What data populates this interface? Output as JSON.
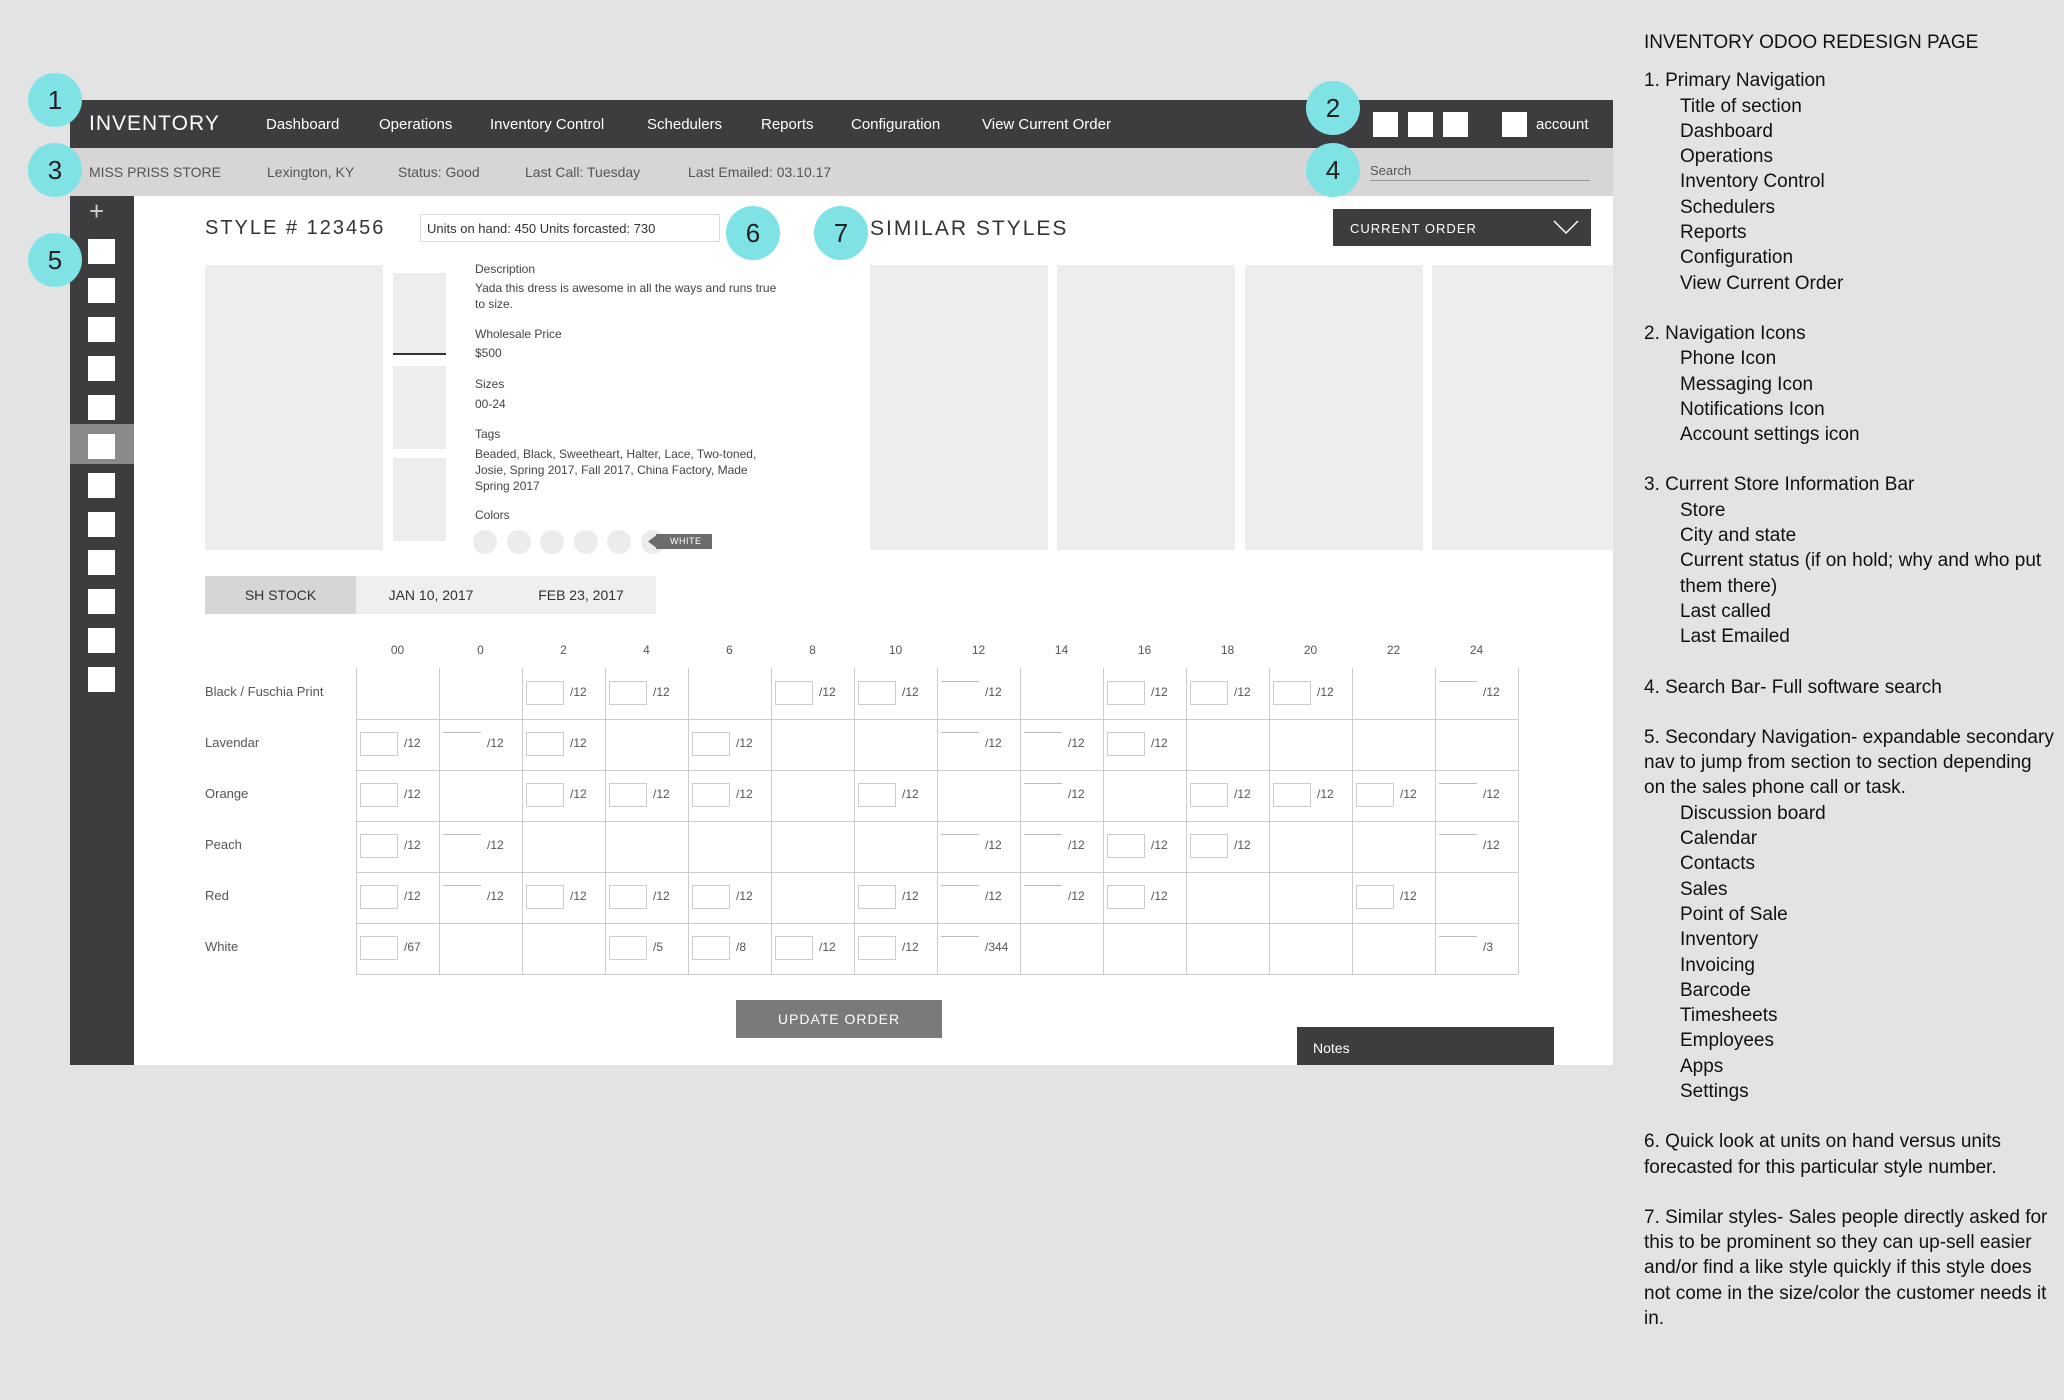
{
  "nav": {
    "title": "INVENTORY",
    "items": [
      "Dashboard",
      "Operations",
      "Inventory Control",
      "Schedulers",
      "Reports",
      "Configuration",
      "View Current Order"
    ],
    "account": "account"
  },
  "info_bar": {
    "store": "MISS PRISS STORE",
    "location": "Lexington, KY",
    "status": "Status: Good",
    "last_call": "Last Call: Tuesday",
    "last_emailed": "Last Emailed: 03.10.17",
    "search_placeholder": "Search"
  },
  "sidebar": {
    "plus": "+"
  },
  "style": {
    "title": "STYLE # 123456",
    "units": "Units on hand: 450   Units forcasted: 730",
    "description_label": "Description",
    "description": "Yada this dress is awesome in all the ways and runs true to size.",
    "price_label": "Wholesale Price",
    "price": "$500",
    "sizes_label": "Sizes",
    "sizes": "00-24",
    "tags_label": "Tags",
    "tags": "Beaded, Black, Sweetheart, Halter, Lace, Two-toned, Josie, Spring 2017, Fall 2017, China Factory, Made Spring 2017",
    "colors_label": "Colors",
    "color_tag": "WHITE"
  },
  "similar": {
    "title": "SIMILAR STYLES"
  },
  "current_order": "CURRENT ORDER",
  "tabs": [
    "SH STOCK",
    "JAN 10, 2017",
    "FEB 23, 2017"
  ],
  "grid": {
    "sizes": [
      "00",
      "0",
      "2",
      "4",
      "6",
      "8",
      "10",
      "12",
      "14",
      "16",
      "18",
      "20",
      "22",
      "24"
    ],
    "rows": [
      {
        "label": "Black / Fuschia Print",
        "cells": [
          null,
          null,
          "box:/12",
          "box:/12",
          null,
          "box:/12",
          "box:/12",
          "line:/12",
          null,
          "box:/12",
          "box:/12",
          "box:/12",
          null,
          "line:/12"
        ]
      },
      {
        "label": "Lavendar",
        "cells": [
          "box:/12",
          "line:/12",
          "box:/12",
          null,
          "box:/12",
          null,
          null,
          "line:/12",
          "line:/12",
          "box:/12",
          null,
          null,
          null,
          null
        ]
      },
      {
        "label": "Orange",
        "cells": [
          "box:/12",
          null,
          "box:/12",
          "box:/12",
          "box:/12",
          null,
          "box:/12",
          null,
          "line:/12",
          null,
          "box:/12",
          "box:/12",
          "box:/12",
          "line:/12"
        ]
      },
      {
        "label": "Peach",
        "cells": [
          "box:/12",
          "line:/12",
          null,
          null,
          null,
          null,
          null,
          "line:/12",
          "line:/12",
          "box:/12",
          "box:/12",
          null,
          null,
          "line:/12"
        ]
      },
      {
        "label": "Red",
        "cells": [
          "box:/12",
          "line:/12",
          "box:/12",
          "box:/12",
          "box:/12",
          null,
          "box:/12",
          "line:/12",
          "line:/12",
          "box:/12",
          null,
          null,
          "box:/12",
          null
        ]
      },
      {
        "label": "White",
        "cells": [
          "box:/67",
          null,
          null,
          "box:/5",
          "box:/8",
          "box:/12",
          "box:/12",
          "line:/344",
          null,
          null,
          null,
          null,
          null,
          "line:/3"
        ]
      }
    ]
  },
  "update_button": "UPDATE ORDER",
  "notes_bar": "Notes",
  "bubbles": [
    "1",
    "2",
    "3",
    "4",
    "5",
    "6",
    "7"
  ],
  "annotations": {
    "heading": "INVENTORY ODOO REDESIGN PAGE",
    "sections": [
      {
        "title": "1. Primary Navigation",
        "items": [
          "Title of section",
          "Dashboard",
          "Operations",
          "Inventory Control",
          "Schedulers",
          "Reports",
          "Configuration",
          "View Current Order"
        ]
      },
      {
        "title": "2. Navigation Icons",
        "items": [
          "Phone Icon",
          "Messaging Icon",
          "Notifications Icon",
          "Account settings icon"
        ]
      },
      {
        "title": "3. Current Store Information Bar",
        "items": [
          "Store",
          "City and state",
          "Current status (if on hold; why and who put them there)",
          "Last called",
          "Last Emailed"
        ]
      },
      {
        "title": "4. Search Bar- Full software search",
        "items": []
      },
      {
        "title": "5. Secondary Navigation- expandable secondary nav to jump from section to section depending on the sales phone call or task.",
        "items": [
          "Discussion board",
          "Calendar",
          "Contacts",
          "Sales",
          "Point of Sale",
          "Inventory",
          "Invoicing",
          "Barcode",
          "Timesheets",
          "Employees",
          "Apps",
          "Settings"
        ]
      },
      {
        "title": "6. Quick look at units on hand versus units forecasted for this particular style number.",
        "items": []
      },
      {
        "title": "7. Similar styles- Sales people directly asked for this to be prominent so they can up-sell easier and/or find a like style quickly if this style does not come in the size/color the customer needs it in.",
        "items": []
      }
    ]
  }
}
